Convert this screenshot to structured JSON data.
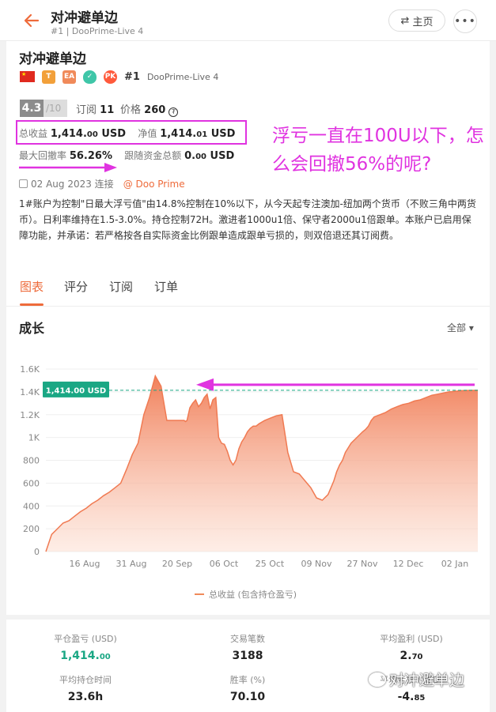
{
  "nav": {
    "title": "对冲避单边",
    "subtitle": "#1 | DooPrime-Live 4",
    "home_label": "主页",
    "more_label": "•••"
  },
  "strategy": {
    "title": "对冲避单边",
    "badges": [
      "T",
      "EA"
    ],
    "pk_label": "PK",
    "rank": "#1",
    "server": "DooPrime-Live 4",
    "rating": "4.3",
    "rating_max": "/10",
    "subs_label": "订阅",
    "subs_value": "11",
    "price_label": "价格",
    "price_value": "260",
    "profit_label": "总收益",
    "profit_main": "1,414.",
    "profit_dec": "00",
    "profit_unit": "USD",
    "equity_label": "净值",
    "equity_main": "1,414.",
    "equity_dec": "01",
    "equity_unit": "USD",
    "dd_label": "最大回撤率",
    "dd_value": "56.26%",
    "follow_label": "跟随资金总额",
    "follow_main": "0.",
    "follow_dec": "00",
    "follow_unit": "USD",
    "date": "02 Aug 2023 连接",
    "broker": "@ Doo Prime",
    "description": "1#账户为控制\"日最大浮亏值\"由14.8%控制在10%以下，从今天起专注澳加-纽加两个货币（不败三角中两货币）。日利率维持在1.5-3.0%。持仓控制72H。激进者1000u1倍、保守者2000u1倍跟单。本账户已启用保障功能，并承诺：若严格按各自实际资金比例跟单造成跟单亏损的，则双倍退还其订阅费。"
  },
  "annotation": "浮亏一直在100U以下，怎么会回撤56%的呢?",
  "tabs": [
    "图表",
    "评分",
    "订阅",
    "订单"
  ],
  "growth": {
    "title": "成长",
    "filter": "全部 ▾",
    "legend": "总收益 (包含持仓盈亏)",
    "current_label": "1,414.00 USD"
  },
  "chart_data": {
    "type": "area",
    "title": "成长",
    "ylabel": "",
    "xlabel": "",
    "ylim": [
      0,
      1600
    ],
    "yticks": [
      "0",
      "200",
      "400",
      "600",
      "800",
      "1K",
      "1.2K",
      "1.4K",
      "1.6K"
    ],
    "xticks": [
      "16 Aug",
      "31 Aug",
      "20 Sep",
      "06 Oct",
      "25 Oct",
      "09 Nov",
      "27 Nov",
      "12 Dec",
      "02 Jan"
    ],
    "x": [
      0,
      2,
      4,
      6,
      8,
      10,
      12,
      14,
      16,
      18,
      20,
      22,
      24,
      26,
      28,
      30,
      32,
      34,
      36,
      38,
      40,
      42,
      44,
      46,
      48,
      48.5,
      49,
      50,
      51,
      52,
      53,
      54,
      55,
      56,
      57,
      58,
      59,
      60,
      61,
      62,
      63,
      64,
      65,
      66,
      67,
      68,
      69,
      70,
      71,
      72,
      73,
      74,
      76,
      78,
      80,
      82,
      84,
      86,
      88,
      90,
      92,
      94,
      96,
      98,
      100,
      101,
      102,
      103,
      104,
      106,
      108,
      110,
      111,
      112,
      113,
      114,
      116,
      118,
      120,
      122,
      124,
      126,
      128,
      130,
      132,
      134,
      136,
      138,
      140,
      142,
      144,
      146,
      148,
      150
    ],
    "values": [
      0,
      150,
      200,
      250,
      270,
      310,
      350,
      380,
      420,
      450,
      490,
      520,
      560,
      600,
      720,
      850,
      950,
      1200,
      1350,
      1540,
      1450,
      1150,
      1150,
      1150,
      1150,
      1140,
      1150,
      1260,
      1300,
      1330,
      1270,
      1300,
      1350,
      1380,
      1250,
      1330,
      1350,
      1000,
      950,
      940,
      880,
      800,
      760,
      800,
      900,
      960,
      1000,
      1050,
      1080,
      1100,
      1100,
      1120,
      1150,
      1170,
      1190,
      1200,
      870,
      700,
      680,
      620,
      560,
      470,
      450,
      500,
      620,
      700,
      760,
      800,
      870,
      950,
      1000,
      1050,
      1070,
      1100,
      1150,
      1180,
      1200,
      1220,
      1250,
      1270,
      1290,
      1300,
      1320,
      1330,
      1350,
      1370,
      1380,
      1390,
      1400,
      1405,
      1410,
      1412,
      1413,
      1414
    ],
    "reference_line": 1414,
    "grid": true
  },
  "stats": [
    {
      "label": "平仓盈亏 (USD)",
      "main": "1,414.",
      "dec": "00",
      "color": "#1aa784"
    },
    {
      "label": "交易笔数",
      "main": "3188",
      "dec": ""
    },
    {
      "label": "平均盈利 (USD)",
      "main": "2.",
      "dec": "70"
    },
    {
      "label": "平均持仓时间",
      "main": "23.6h",
      "dec": ""
    },
    {
      "label": "胜率 (%)",
      "main": "70.10",
      "dec": ""
    },
    {
      "label": "平均亏损 (USD)",
      "main": "-4.",
      "dec": "85"
    }
  ],
  "watermark": "对冲避单边",
  "colors": {
    "accent": "#ee6b3b",
    "annotation": "#e033e0",
    "teal": "#1aa784"
  }
}
